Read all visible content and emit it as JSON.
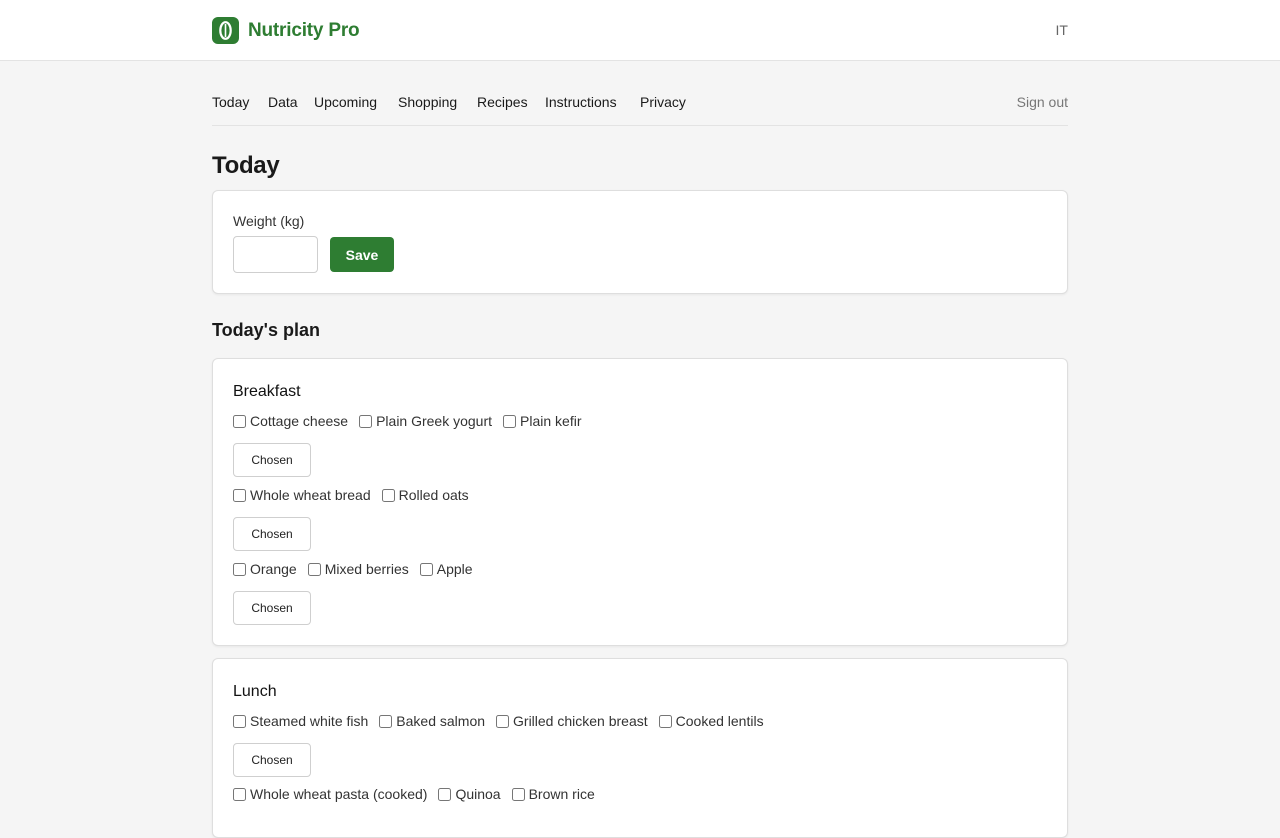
{
  "app": {
    "brand_name": "Nutricity Pro",
    "accent_color": "#2e7d32",
    "logo_icon": "leaf-icon",
    "language": "IT"
  },
  "nav": {
    "items": [
      "Today",
      "Data",
      "Upcoming",
      "Shopping",
      "Recipes",
      "Instructions",
      "Privacy"
    ],
    "sign_out": "Sign out"
  },
  "page": {
    "title": "Today"
  },
  "weight": {
    "label": "Weight (kg)",
    "value": "",
    "save_label": "Save"
  },
  "plan": {
    "title": "Today's plan",
    "chosen_label": "Chosen",
    "breakfast": {
      "title": "Breakfast",
      "groups": [
        [
          "Cottage cheese",
          "Plain Greek yogurt",
          "Plain kefir"
        ],
        [
          "Whole wheat bread",
          "Rolled oats"
        ],
        [
          "Orange",
          "Mixed berries",
          "Apple"
        ]
      ]
    },
    "lunch": {
      "title": "Lunch",
      "groups": [
        [
          "Steamed white fish",
          "Baked salmon",
          "Grilled chicken breast",
          "Cooked lentils"
        ],
        [
          "Whole wheat pasta (cooked)",
          "Quinoa",
          "Brown rice"
        ]
      ]
    }
  }
}
